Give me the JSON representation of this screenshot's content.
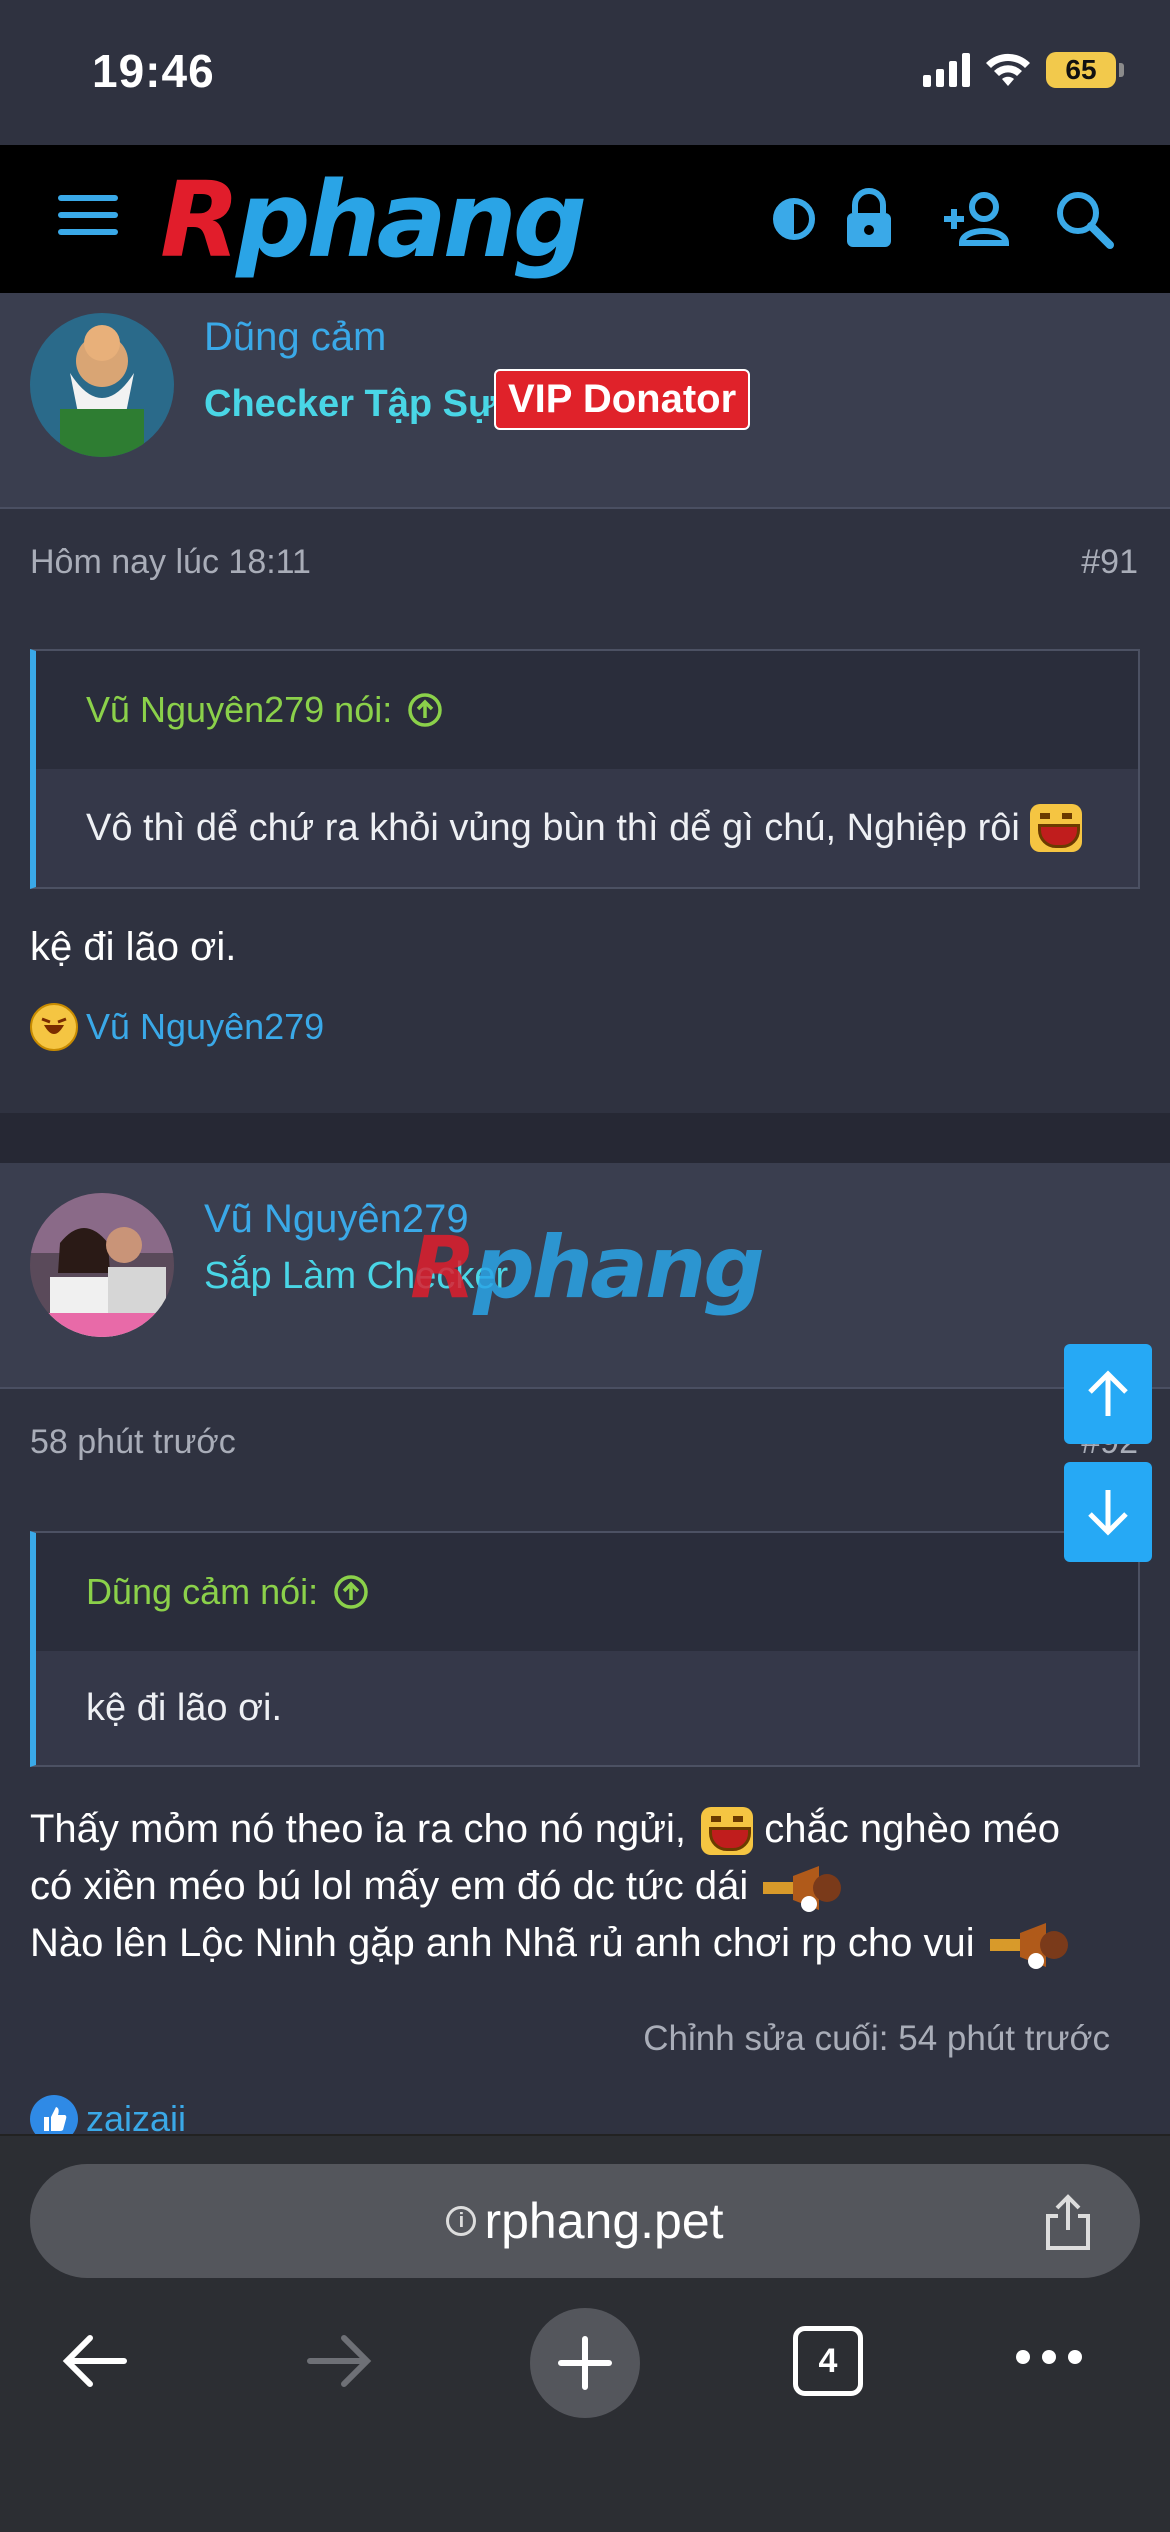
{
  "status_bar": {
    "time": "19:46",
    "battery": "65"
  },
  "header": {
    "logo_prefix": "R",
    "logo_rest": "phang"
  },
  "posts": [
    {
      "username": "Dũng cảm",
      "user_title": "Checker Tập Sự",
      "badge": "VIP Donator",
      "timestamp": "Hôm nay lúc 18:11",
      "post_number": "#91",
      "quote_author": "Vũ Nguyên279 nói:",
      "quote_text": "Vô thì dể chứ ra khỏi vủng bùn thì dể gì chú, Nghiệp rôi",
      "body": "kệ đi lão ơi.",
      "reaction_user": "Vũ Nguyên279"
    },
    {
      "username": "Vũ Nguyên279",
      "user_title": "Sắp Làm Checker",
      "timestamp": "58 phút trước",
      "post_number": "#92",
      "quote_author": "Dũng cảm nói:",
      "quote_text": "kệ đi lão ơi.",
      "body_line1_a": "Thấy mỏm nó theo ỉa ra cho nó ngửi,",
      "body_line1_b": "chắc nghèo méo",
      "body_line2": "có xiền méo bú lol mấy em đó dc tức dái",
      "body_line3": "Nào lên Lộc Ninh gặp anh Nhã rủ anh chơi rp cho vui",
      "edited": "Chỉnh sửa cuối: 54 phút trước",
      "reaction_user": "zaizaii"
    }
  ],
  "watermark": {
    "prefix": "R",
    "rest": "phang"
  },
  "browser": {
    "url": "rphang.pet",
    "tab_count": "4"
  },
  "colors": {
    "accent": "#3aa9e8",
    "title": "#49d6e6",
    "quote_author": "#8bd14a",
    "vip": "#e0222a",
    "scroll_button": "#26a9f5"
  }
}
